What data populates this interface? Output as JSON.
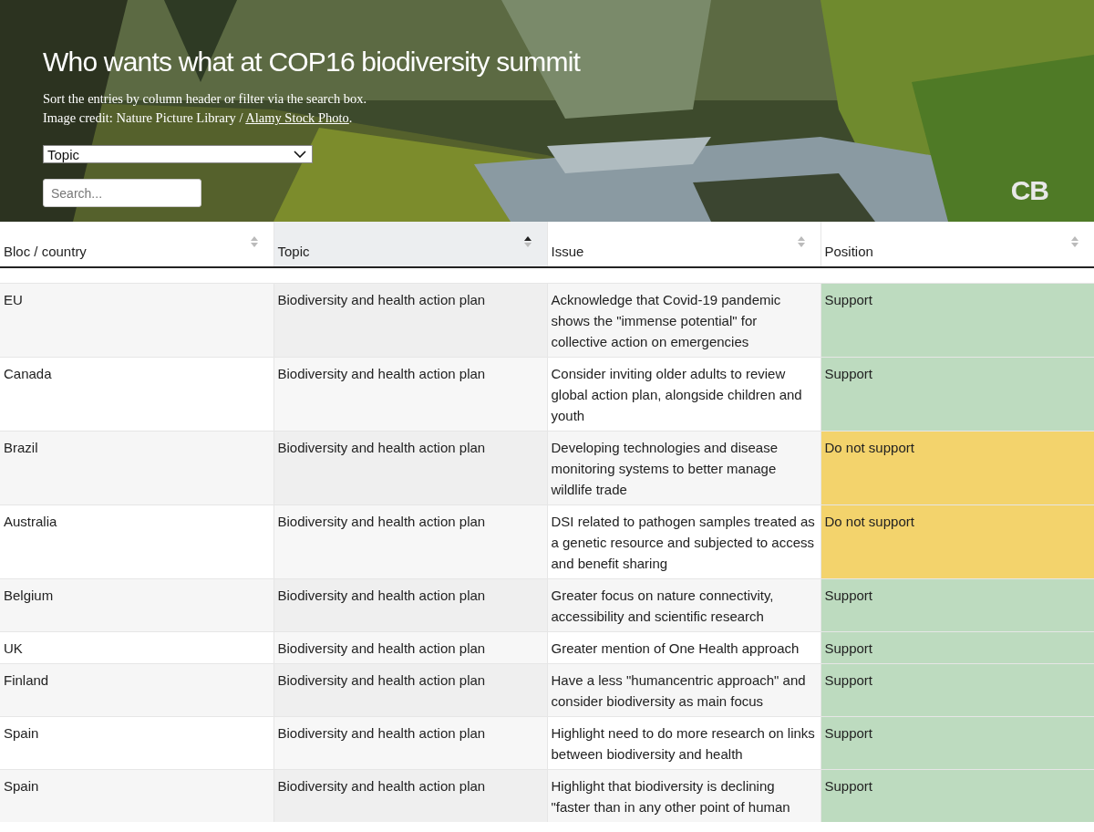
{
  "header": {
    "title": "Who wants what at COP16 biodiversity summit",
    "intro": "Sort the entries by column header or filter via the search box.",
    "credit": {
      "text": "Image credit: Nature Picture Library / ",
      "link": "Alamy Stock Photo",
      "tail": "."
    },
    "filter": {
      "value": "Topic"
    },
    "search": {
      "placeholder": "Search..."
    },
    "logo": "CB"
  },
  "table": {
    "columns": [
      {
        "label": "Bloc / country",
        "selected": false
      },
      {
        "label": "Topic",
        "selected": true
      },
      {
        "label": "Issue",
        "selected": false
      },
      {
        "label": "Position",
        "selected": false
      }
    ],
    "rows": [
      {
        "bloc": "EU",
        "topic": "Biodiversity and health action plan",
        "issue": "Acknowledge that Covid-19 pandemic shows the \"immense potential\" for collective action on emergencies",
        "position": "Support",
        "color": "#bddbbf"
      },
      {
        "bloc": "Canada",
        "topic": "Biodiversity and health action plan",
        "issue": "Consider inviting older adults to review global action plan, alongside children and youth",
        "position": "Support",
        "color": "#bddbbf"
      },
      {
        "bloc": "Brazil",
        "topic": "Biodiversity and health action plan",
        "issue": "Developing technologies and disease monitoring systems to better manage wildlife trade",
        "position": "Do not support",
        "color": "#f3d36c"
      },
      {
        "bloc": "Australia",
        "topic": "Biodiversity and health action plan",
        "issue": "DSI related to pathogen samples treated as a genetic resource and subjected to access and benefit sharing",
        "position": "Do not support",
        "color": "#f3d36c"
      },
      {
        "bloc": "Belgium",
        "topic": "Biodiversity and health action plan",
        "issue": "Greater focus on nature connectivity, accessibility and scientific research",
        "position": "Support",
        "color": "#bddbbf"
      },
      {
        "bloc": "UK",
        "topic": "Biodiversity and health action plan",
        "issue": "Greater mention of One Health approach",
        "position": "Support",
        "color": "#bddbbf"
      },
      {
        "bloc": "Finland",
        "topic": "Biodiversity and health action plan",
        "issue": "Have a less \"humancentric approach\" and consider biodiversity as main focus",
        "position": "Support",
        "color": "#bddbbf"
      },
      {
        "bloc": "Spain",
        "topic": "Biodiversity and health action plan",
        "issue": "Highlight need to do more research on links between biodiversity and health",
        "position": "Support",
        "color": "#bddbbf"
      },
      {
        "bloc": "Spain",
        "topic": "Biodiversity and health action plan",
        "issue": "Highlight that biodiversity is declining \"faster than in any other point of human",
        "position": "Support",
        "color": "#bddbbf"
      }
    ]
  }
}
